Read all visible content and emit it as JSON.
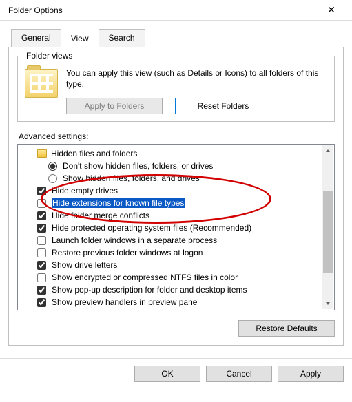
{
  "window": {
    "title": "Folder Options",
    "close": "✕"
  },
  "tabs": {
    "general": "General",
    "view": "View",
    "search": "Search"
  },
  "folderViews": {
    "legend": "Folder views",
    "description": "You can apply this view (such as Details or Icons) to all folders of this type.",
    "applyBtn": "Apply to Folders",
    "resetBtn": "Reset Folders"
  },
  "advanced": {
    "label": "Advanced settings:",
    "group": "Hidden files and folders",
    "radio1": "Don't show hidden files, folders, or drives",
    "radio2": "Show hidden files, folders, and drives",
    "c1": "Hide empty drives",
    "c2": "Hide extensions for known file types",
    "c3": "Hide folder merge conflicts",
    "c4": "Hide protected operating system files (Recommended)",
    "c5": "Launch folder windows in a separate process",
    "c6": "Restore previous folder windows at logon",
    "c7": "Show drive letters",
    "c8": "Show encrypted or compressed NTFS files in color",
    "c9": "Show pop-up description for folder and desktop items",
    "c10": "Show preview handlers in preview pane"
  },
  "buttons": {
    "restore": "Restore Defaults",
    "ok": "OK",
    "cancel": "Cancel",
    "apply": "Apply"
  }
}
